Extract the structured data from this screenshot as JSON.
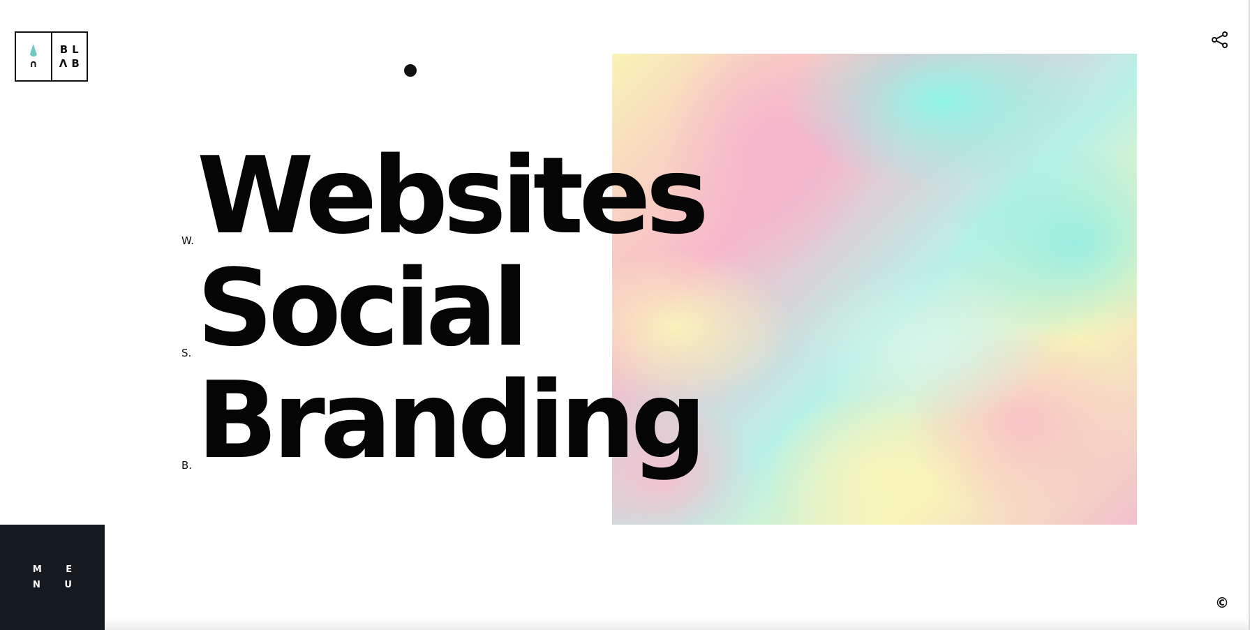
{
  "logo": {
    "left_bottom": "∩",
    "right_top": "BL",
    "right_bottom": "ΛB",
    "accent_color": "#6dc9c1"
  },
  "headline": {
    "lines": [
      {
        "marker": "W.",
        "text": "Websites"
      },
      {
        "marker": "S.",
        "text": "Social"
      },
      {
        "marker": "B.",
        "text": "Branding"
      }
    ]
  },
  "menu": {
    "row1": "M E",
    "row2": "N U",
    "background": "#141a1d"
  },
  "share_icon": "share-icon",
  "copyright": "©"
}
